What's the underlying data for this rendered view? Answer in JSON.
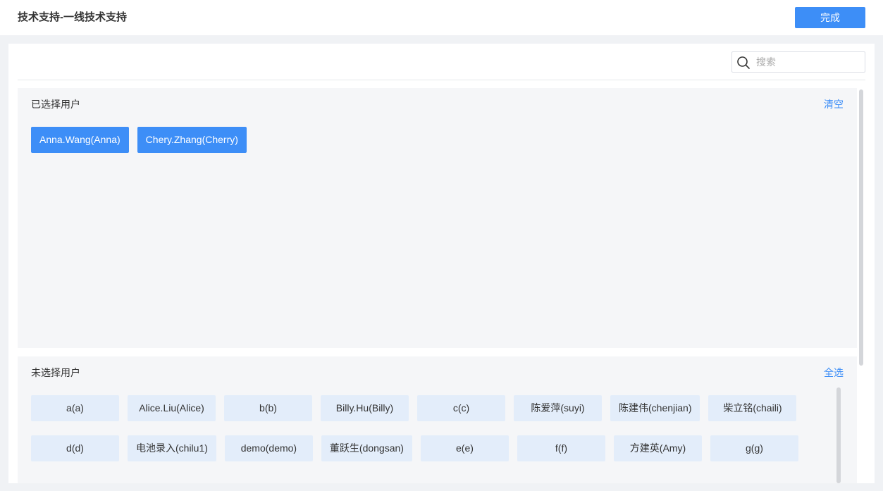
{
  "header": {
    "title": "技术支持-一线技术支持",
    "done_label": "完成"
  },
  "search": {
    "placeholder": "搜索",
    "value": ""
  },
  "selected": {
    "label": "已选择用户",
    "action_label": "清空",
    "users": [
      "Anna.Wang(Anna)",
      "Chery.Zhang(Cherry)"
    ]
  },
  "unselected": {
    "label": "未选择用户",
    "action_label": "全选",
    "rows": [
      [
        "a(a)",
        "Alice.Liu(Alice)",
        "b(b)",
        "Billy.Hu(Billy)",
        "c(c)",
        "陈爱萍(suyi)",
        "陈建伟(chenjian)",
        "柴立铭(chaili)"
      ],
      [
        "d(d)",
        "电池录入(chilu1)",
        "demo(demo)",
        "董跃生(dongsan)",
        "e(e)",
        "f(f)",
        "方建英(Amy)",
        "g(g)"
      ]
    ]
  },
  "colors": {
    "accent": "#3d8ef7",
    "chip_bg": "#e3edfa",
    "section_bg": "#f5f6f8"
  }
}
